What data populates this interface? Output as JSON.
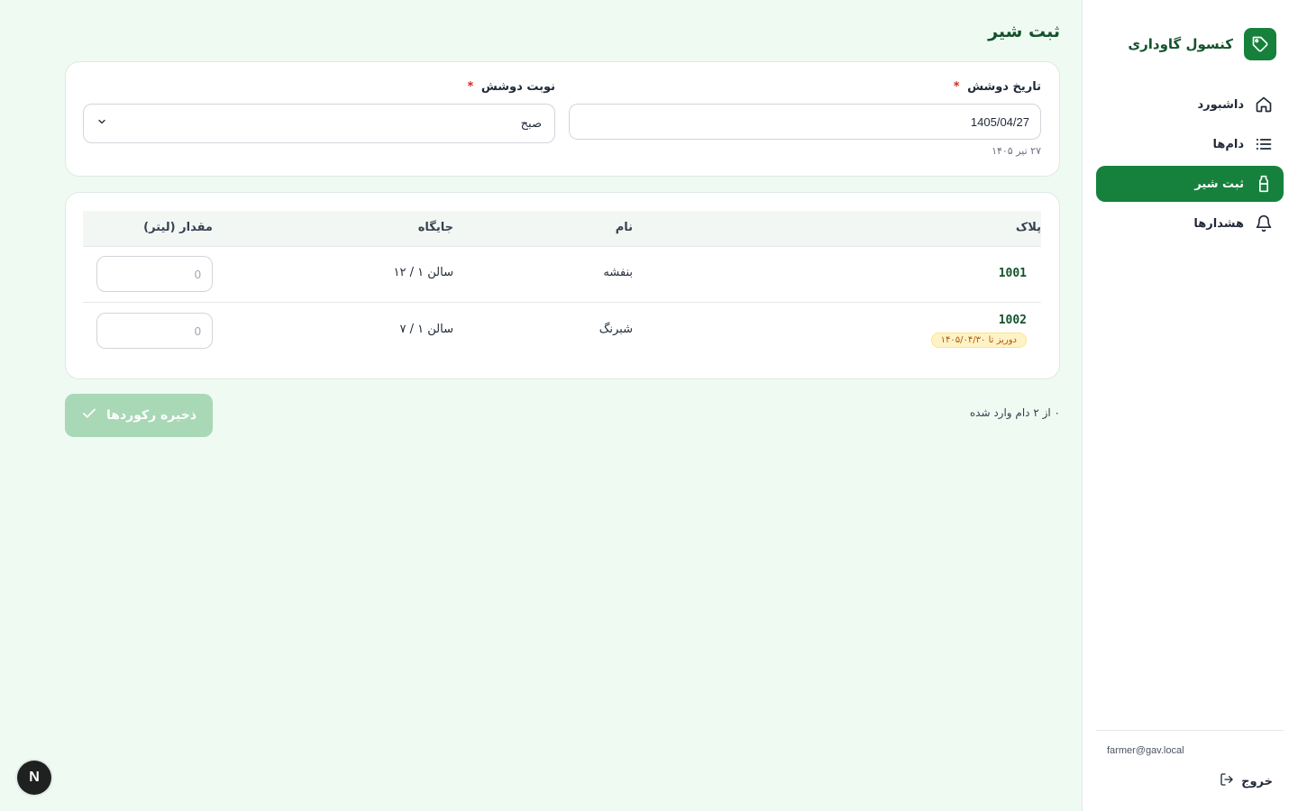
{
  "app": {
    "title": "کنسول گاوداری",
    "brand_icon": "tag-icon"
  },
  "sidebar": {
    "items": [
      {
        "label": "داشبورد",
        "icon": "home-icon",
        "active": false
      },
      {
        "label": "دام‌ها",
        "icon": "list-icon",
        "active": false
      },
      {
        "label": "ثبت شیر",
        "icon": "milk-bottle-icon",
        "active": true
      },
      {
        "label": "هشدارها",
        "icon": "bell-icon",
        "active": false
      }
    ],
    "user_email": "farmer@gav.local",
    "logout_label": "خروج"
  },
  "page": {
    "title": "ثبت شیر"
  },
  "form": {
    "date_label": "تاریخ دوشش",
    "date_value": "1405/04/27",
    "date_hint": "۲۷ تیر ۱۴۰۵",
    "shift_label": "نوبت دوشش",
    "shift_value": "صبح",
    "required_mark": "*"
  },
  "table": {
    "headers": {
      "plate": "پلاک",
      "name": "نام",
      "location": "جایگاه",
      "quantity": "مقدار (لیتر)"
    },
    "rows": [
      {
        "plate": "1001",
        "name": "بنفشه",
        "location": "سالن ۱ / ۱۲",
        "quantity_placeholder": "0",
        "badge": ""
      },
      {
        "plate": "1002",
        "name": "شبرنگ",
        "location": "سالن ۱ / ۷",
        "quantity_placeholder": "0",
        "badge": "دوریز تا ۱۴۰۵/۰۴/۳۰"
      }
    ]
  },
  "footer": {
    "count_text": "۰ از ۲ دام وارد شده",
    "save_label": "ذخیره رکوردها"
  },
  "dev_badge": "N",
  "colors": {
    "primary": "#16813c",
    "background": "#effaf2",
    "warning": "#b45309"
  }
}
